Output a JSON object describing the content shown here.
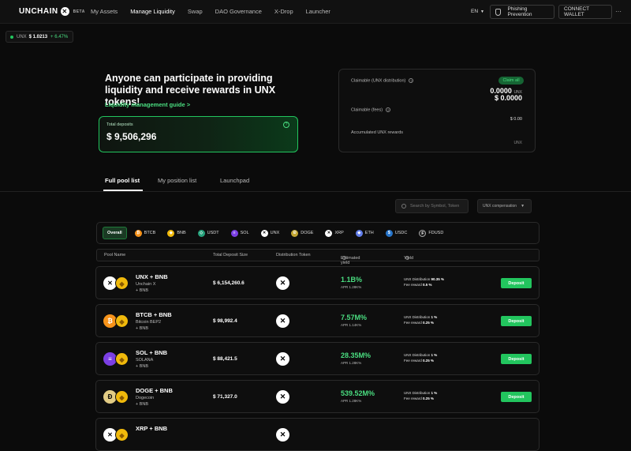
{
  "nav": {
    "brand": "UNCHAIN",
    "brand_version": "BETA",
    "links": [
      {
        "label": "My Assets"
      },
      {
        "label": "Manage Liquidity"
      },
      {
        "label": "Swap"
      },
      {
        "label": "DAO Governance"
      },
      {
        "label": "X-Drop"
      },
      {
        "label": "Launcher"
      }
    ],
    "active_link": "Manage Liquidity",
    "language": "EN",
    "phishing_label": "Phishing Prevention",
    "connect_label": "CONNECT WALLET",
    "more_label": "···"
  },
  "ticker": {
    "symbol": "UNX",
    "price": "$ 1.0213",
    "change": "+ 6.47%"
  },
  "hero": {
    "title": "Anyone can participate in providing liquidity and receive rewards in UNX tokens!",
    "guide_link": "Liquidity management guide >",
    "total_label": "Total deposits",
    "total_value": "$ 9,506,296"
  },
  "claim": {
    "claimable_unx_label": "Claimable (UNX distribution)",
    "claim_all_label": "Claim all",
    "unx_amount": "0.0000",
    "unx_unit": "UNX",
    "usd_amount": "$ 0.0000",
    "fees_label": "Claimable (fees)",
    "fees_value": "$ 0.00",
    "accumulated_label": "Accumulated UNX rewards",
    "accumulated_unit": "UNX"
  },
  "tabs": [
    {
      "label": "Full pool list"
    },
    {
      "label": "My position list"
    },
    {
      "label": "Launchpad"
    }
  ],
  "search": {
    "placeholder": "Search by Symbol, Token"
  },
  "sort": {
    "selected": "UNX compensation"
  },
  "filters": [
    {
      "label": "Overall",
      "color": "",
      "glyph": ""
    },
    {
      "label": "BTCB",
      "color": "#f7931a",
      "glyph": "₿"
    },
    {
      "label": "BNB",
      "color": "#f0b90b",
      "glyph": "◆"
    },
    {
      "label": "USDT",
      "color": "#26a17b",
      "glyph": "◇"
    },
    {
      "label": "SOL",
      "color": "#7b3fe4",
      "glyph": "≡"
    },
    {
      "label": "UNX",
      "color": "#ffffff",
      "glyph": "✕"
    },
    {
      "label": "DOGE",
      "color": "#c2a633",
      "glyph": "Ð"
    },
    {
      "label": "XRP",
      "color": "#ffffff",
      "glyph": "✕"
    },
    {
      "label": "ETH",
      "color": "#627eea",
      "glyph": "◆"
    },
    {
      "label": "USDC",
      "color": "#2775ca",
      "glyph": "$"
    },
    {
      "label": "FDUSD",
      "color": "#1c1c1c",
      "glyph": "F"
    }
  ],
  "table": {
    "headers": [
      "Pool Name",
      "Total Deposit Size",
      "Distribution Token",
      "Estimated yield",
      "Yield"
    ]
  },
  "pools": [
    {
      "name": "UNX + BNB",
      "sub1": "Unchain X",
      "sub2": "+ BNB",
      "deposit": "$ 6,154,260.6",
      "yield": "1.1B%",
      "apr": "APR 1.28K%",
      "dist_label": "UNX Distribution",
      "dist_value": "90.35 %",
      "fee_label": "Fee reward",
      "fee_value": "0.5 %",
      "icon_color": "#ffffff",
      "icon_text": "✕",
      "deposit_label": "Deposit"
    },
    {
      "name": "BTCB + BNB",
      "sub1": "Bitcoin BEP2",
      "sub2": "+ BNB",
      "deposit": "$ 98,992.4",
      "yield": "7.57M%",
      "apr": "APR 1.14K%",
      "dist_label": "UNX Distribution",
      "dist_value": "1 %",
      "fee_label": "Fee reward",
      "fee_value": "0.25 %",
      "icon_color": "#f7931a",
      "icon_text": "₿",
      "deposit_label": "Deposit"
    },
    {
      "name": "SOL + BNB",
      "sub1": "SOLANA",
      "sub2": "+ BNB",
      "deposit": "$ 88,421.5",
      "yield": "28.35M%",
      "apr": "APR 1.28K%",
      "dist_label": "UNX Distribution",
      "dist_value": "1 %",
      "fee_label": "Fee reward",
      "fee_value": "0.25 %",
      "icon_color": "#7b3fe4",
      "icon_text": "≡",
      "deposit_label": "Deposit"
    },
    {
      "name": "DOGE + BNB",
      "sub1": "Dogecoin",
      "sub2": "+ BNB",
      "deposit": "$ 71,327.0",
      "yield": "539.52M%",
      "apr": "APR 1.28K%",
      "dist_label": "UNX Distribution",
      "dist_value": "1 %",
      "fee_label": "Fee reward",
      "fee_value": "0.25 %",
      "icon_color": "#e2cc85",
      "icon_text": "Ð",
      "deposit_label": "Deposit"
    },
    {
      "name": "XRP + BNB",
      "sub1": "",
      "sub2": "",
      "deposit": "",
      "yield": "",
      "apr": "",
      "dist_label": "",
      "dist_value": "",
      "fee_label": "",
      "fee_value": "",
      "icon_color": "#ffffff",
      "icon_text": "✕",
      "deposit_label": ""
    }
  ]
}
